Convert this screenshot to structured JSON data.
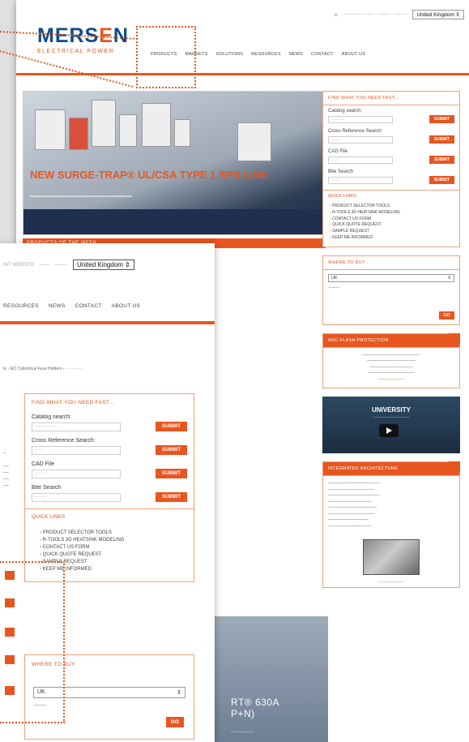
{
  "brand": {
    "logo_main_1": "MERS",
    "logo_main_2": "E",
    "logo_main_3": "N",
    "logo_sub": "ELECTRICAL POWER"
  },
  "topbar": {
    "country": "United Kingdom"
  },
  "nav": {
    "items": [
      "PRODUCTS",
      "MARKETS",
      "SOLUTIONS",
      "RESOURCES",
      "NEWS",
      "CONTACT",
      "ABOUT US"
    ]
  },
  "hero": {
    "title": "NEW SURGE-TRAP® UL/CSA TYPE 1 SPD LINE"
  },
  "potw": {
    "label": "PRODUCTS OF THE WEEK"
  },
  "find": {
    "title": "FIND WHAT YOU NEED FAST...",
    "fields": [
      {
        "label": "Catalog search:",
        "submit": "SUBMIT"
      },
      {
        "label": "Cross Reference Search:",
        "submit": "SUBMIT"
      },
      {
        "label": "CAD File",
        "submit": "SUBMIT"
      },
      {
        "label": "Bite Search",
        "submit": "SUBMIT"
      }
    ]
  },
  "quick_links": {
    "title": "QUICK LINKS",
    "items": [
      "PRODUCT SELECTOR TOOLS",
      "R-TOOLS 3D HEATSINK MODELING",
      "CONTACT US FORM",
      "QUICK QUOTE REQUEST",
      "SAMPLE REQUEST",
      "KEEP ME INFORMED"
    ]
  },
  "where": {
    "title": "WHERE TO BUY",
    "country": "UK",
    "go": "GO"
  },
  "arc": {
    "title": "ARC-FLASH PROTECTION"
  },
  "video": {
    "title": "UNIVERSITY"
  },
  "integrated": {
    "title": "INTEGRATED ARCHITECTURE"
  },
  "banner": {
    "line1": "RT® 630A",
    "line2": "P+N)"
  },
  "front": {
    "topbar_text": "INT WEBSITE",
    "country": "United Kingdom",
    "nav": [
      "RESOURCES",
      "NEWS",
      "CONTACT",
      "ABOUT US"
    ],
    "breadcrumb": "ts › IEC Cylindrical Fuse Holders ›"
  }
}
